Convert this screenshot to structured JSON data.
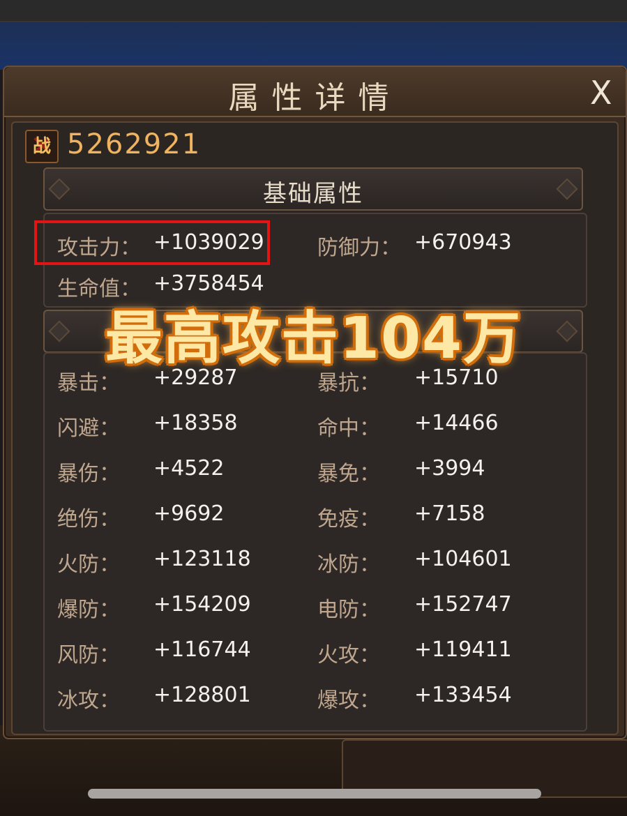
{
  "dialog": {
    "title": "属性详情",
    "close_label": "X",
    "power_icon_char": "战",
    "power_value": "5262921"
  },
  "basic": {
    "heading": "基础属性",
    "rows": [
      [
        {
          "label": "攻击力：",
          "value": "+1039029"
        },
        {
          "label": "防御力：",
          "value": "+670943"
        }
      ],
      [
        {
          "label": "生命值：",
          "value": "+3758454"
        }
      ]
    ]
  },
  "advanced": {
    "rows": [
      [
        {
          "label": "暴击：",
          "value": "+29287"
        },
        {
          "label": "暴抗：",
          "value": "+15710"
        }
      ],
      [
        {
          "label": "闪避：",
          "value": "+18358"
        },
        {
          "label": "命中：",
          "value": "+14466"
        }
      ],
      [
        {
          "label": "暴伤：",
          "value": "+4522"
        },
        {
          "label": "暴免：",
          "value": "+3994"
        }
      ],
      [
        {
          "label": "绝伤：",
          "value": "+9692"
        },
        {
          "label": "免疫：",
          "value": "+7158"
        }
      ],
      [
        {
          "label": "火防：",
          "value": "+123118"
        },
        {
          "label": "冰防：",
          "value": "+104601"
        }
      ],
      [
        {
          "label": "爆防：",
          "value": "+154209"
        },
        {
          "label": "电防：",
          "value": "+152747"
        }
      ],
      [
        {
          "label": "风防：",
          "value": "+116744"
        },
        {
          "label": "火攻：",
          "value": "+119411"
        }
      ],
      [
        {
          "label": "冰攻：",
          "value": "+128801"
        },
        {
          "label": "爆攻：",
          "value": "+133454"
        }
      ]
    ]
  },
  "overlay_caption": "最高攻击104万",
  "colors": {
    "highlight": "#e31414",
    "label": "#bfa68e",
    "value": "#f4f1ee",
    "power": "#f0b35f"
  }
}
